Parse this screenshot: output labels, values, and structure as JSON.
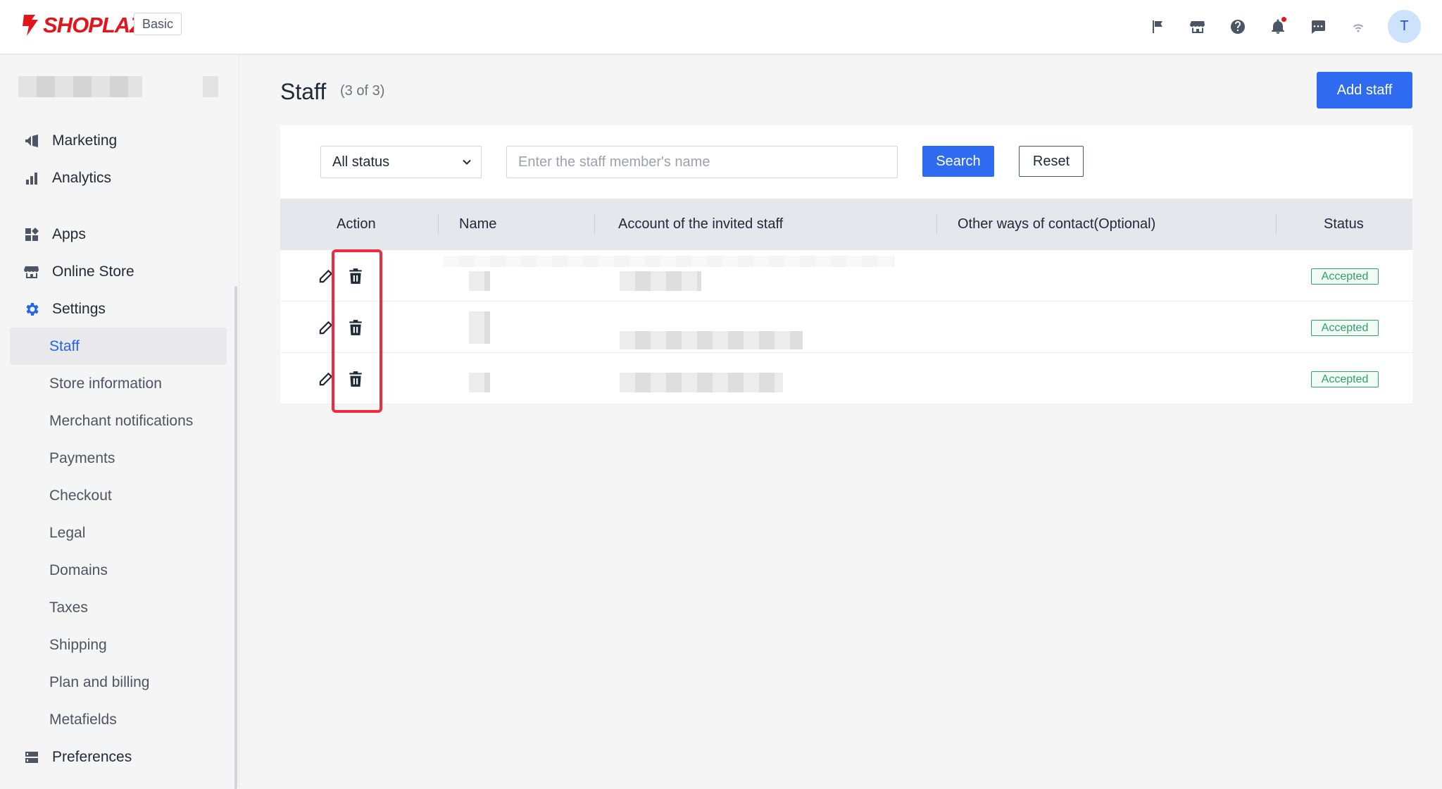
{
  "header": {
    "brand": "SHOPLAZZA",
    "plan_badge": "Basic",
    "avatar_initial": "T",
    "brand_color": "#e3141b",
    "icons": [
      "flag-icon",
      "storefront-icon",
      "help-icon",
      "bell-icon",
      "chat-icon",
      "wifi-icon"
    ]
  },
  "sidebar": {
    "main_items": [
      {
        "label": "Marketing",
        "icon": "megaphone-icon"
      },
      {
        "label": "Analytics",
        "icon": "bar-chart-icon"
      },
      {
        "label": "Apps",
        "icon": "apps-icon"
      },
      {
        "label": "Online Store",
        "icon": "storefront-icon"
      },
      {
        "label": "Settings",
        "icon": "gear-icon"
      }
    ],
    "settings_items": [
      {
        "label": "Staff",
        "active": true
      },
      {
        "label": "Store information"
      },
      {
        "label": "Merchant notifications"
      },
      {
        "label": "Payments"
      },
      {
        "label": "Checkout"
      },
      {
        "label": "Legal"
      },
      {
        "label": "Domains"
      },
      {
        "label": "Taxes"
      },
      {
        "label": "Shipping"
      },
      {
        "label": "Plan and billing"
      },
      {
        "label": "Metafields"
      }
    ],
    "preferences": {
      "label": "Preferences",
      "icon": "server-icon"
    }
  },
  "page": {
    "title": "Staff",
    "count": "(3 of 3)",
    "add_button": "Add staff"
  },
  "filters": {
    "status_selected": "All status",
    "search_placeholder": "Enter the staff member's name",
    "search_button": "Search",
    "reset_button": "Reset"
  },
  "table": {
    "columns": [
      "Action",
      "Name",
      "Account of the invited staff",
      "Other ways of contact(Optional)",
      "Status"
    ],
    "rows": [
      {
        "status": "Accepted"
      },
      {
        "status": "Accepted"
      },
      {
        "status": "Accepted"
      }
    ]
  },
  "colors": {
    "primary": "#2f6bf0",
    "accepted": "#2ea06b",
    "highlight": "#ef2b41"
  }
}
